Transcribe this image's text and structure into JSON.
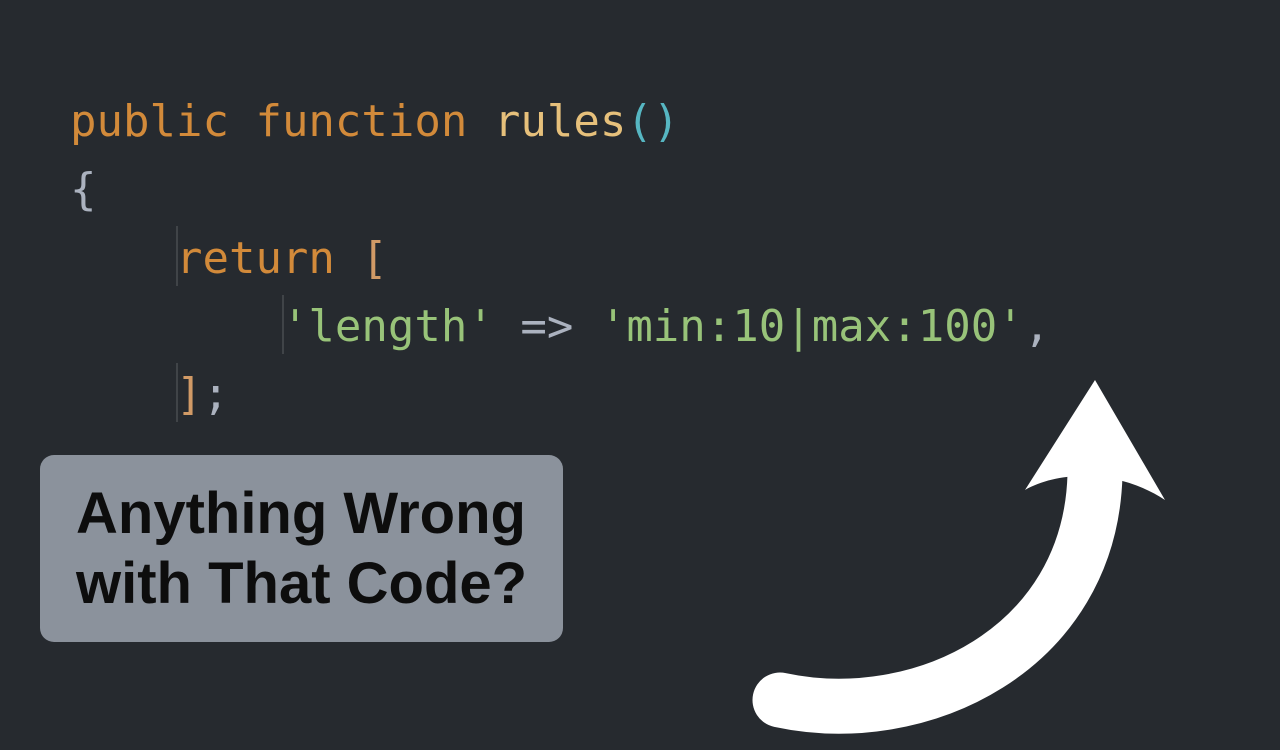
{
  "code": {
    "line1": {
      "kw_public": "public",
      "kw_function": "function",
      "fn_name": "rules",
      "parens_open": "(",
      "parens_close": ")"
    },
    "line2": {
      "brace_open": "{"
    },
    "line3": {
      "kw_return": "return",
      "bracket_open": "["
    },
    "line4": {
      "key": "'length'",
      "arrow": "=>",
      "value": "'min:10|max:100'",
      "comma": ","
    },
    "line5": {
      "bracket_close": "]",
      "semicolon": ";"
    }
  },
  "callout": {
    "line1": "Anything Wrong",
    "line2": "with That Code?"
  }
}
